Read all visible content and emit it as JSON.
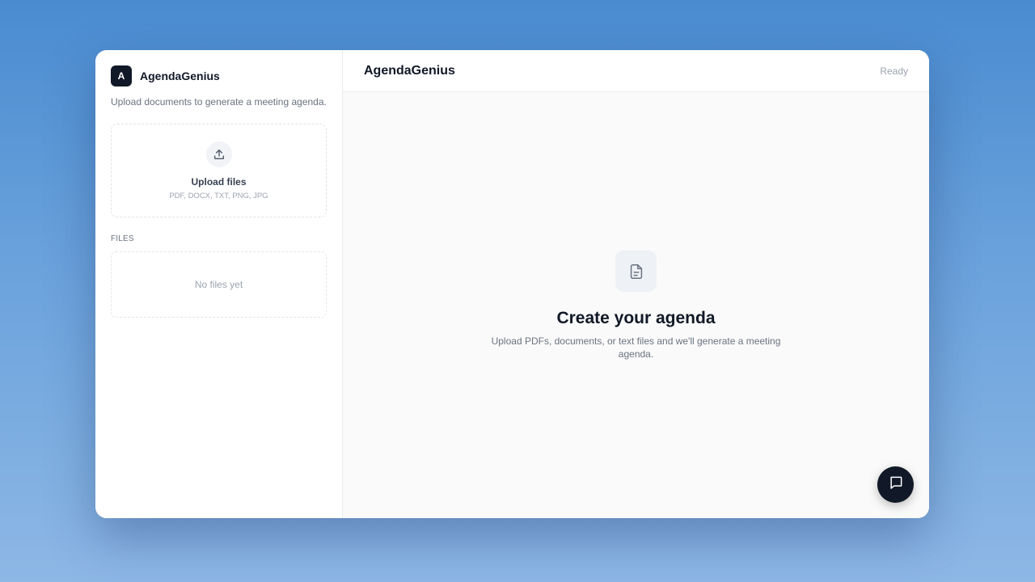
{
  "sidebar": {
    "logo_letter": "A",
    "brand_name": "AgendaGenius",
    "subtitle": "Upload documents to generate a meeting agenda.",
    "upload": {
      "icon": "upload-icon",
      "title": "Upload files",
      "hint": "PDF, DOCX, TXT, PNG, JPG"
    },
    "files_label": "FILES",
    "files_empty": "No files yet"
  },
  "header": {
    "title": "AgendaGenius",
    "status": "Ready"
  },
  "main": {
    "icon": "document-icon",
    "title": "Create your agenda",
    "description": "Upload PDFs, documents, or text files and we'll generate a meeting agenda."
  },
  "chat_button": {
    "icon": "chat-icon"
  },
  "colors": {
    "brand_dark": "#111827",
    "muted_text": "#6b7280",
    "light_text": "#9ca3af",
    "background_blue": "#4a8bd0"
  }
}
